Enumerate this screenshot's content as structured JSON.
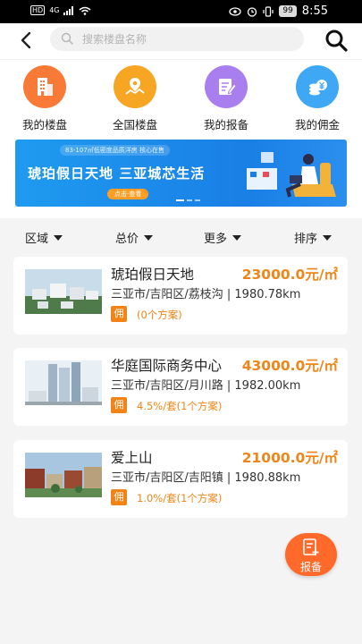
{
  "status_bar": {
    "hd": "HD",
    "signal": "4G",
    "battery": "99",
    "time": "8:55"
  },
  "search": {
    "placeholder": "搜索楼盘名称"
  },
  "quick_actions": [
    {
      "label": "我的楼盘",
      "icon": "building-icon",
      "color": "#f97a36"
    },
    {
      "label": "全国楼盘",
      "icon": "map-pin-icon",
      "color": "#f6a623"
    },
    {
      "label": "我的报备",
      "icon": "edit-document-icon",
      "color": "#a97ff0"
    },
    {
      "label": "我的佣金",
      "icon": "coins-yen-icon",
      "color": "#3fa8f5"
    }
  ],
  "banner": {
    "subtitle": "83-107㎡低密度品质洋房 核心在售",
    "title": "琥珀假日天地 三亚城芯生活",
    "button": "点击·查看"
  },
  "filters": [
    {
      "label": "区域"
    },
    {
      "label": "总价"
    },
    {
      "label": "更多"
    },
    {
      "label": "排序"
    }
  ],
  "listings": [
    {
      "name": "琥珀假日天地",
      "price": "23000.0元/㎡",
      "address": "三亚市/吉阳区/荔枝沟 | 1980.78km",
      "tag": "佣",
      "commission": "(0个方案)"
    },
    {
      "name": "华庭国际商务中心",
      "price": "43000.0元/㎡",
      "address": "三亚市/吉阳区/月川路 | 1982.00km",
      "tag": "佣",
      "commission": "4.5%/套(1个方案)"
    },
    {
      "name": "爱上山",
      "price": "21000.0元/㎡",
      "address": "三亚市/吉阳区/吉阳镇 | 1980.88km",
      "tag": "佣",
      "commission": "1.0%/套(1个方案)"
    }
  ],
  "fab": {
    "label": "报备"
  }
}
